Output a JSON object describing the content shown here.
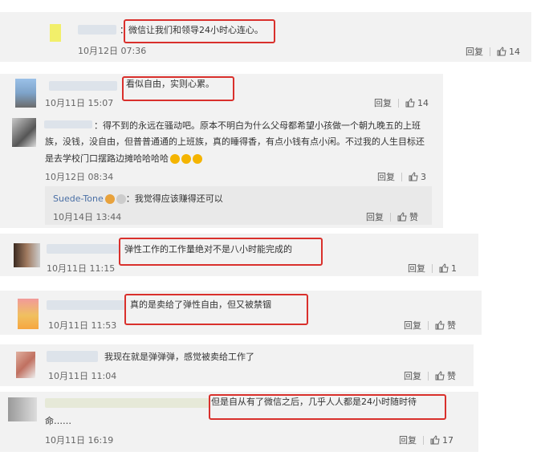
{
  "comments": [
    {
      "text": "：微信让我们和领导24小时心连心。",
      "time": "10月12日 07:36",
      "reply": "回复",
      "likes": "14"
    },
    {
      "text": "看似自由，实则心累。",
      "time": "10月11日 15:07",
      "reply": "回复",
      "likes": "14"
    },
    {
      "text_lines": [
        "：得不到的永远在骚动吧。原本不明白为什么父母都希望小孩做一个朝九晚五的上班",
        "族，没钱，没自由，但普普通通的上班族，真的睡得香，有点小钱有点小闲。不过我的人生目标还",
        "是去学校门口摆路边摊哈哈哈哈"
      ],
      "time": "10月12日 08:34",
      "reply": "回复",
      "likes": "3",
      "subreply": {
        "user": "Suede-Tone",
        "text": "：我觉得应该赚得还可以",
        "time": "10月14日 13:44",
        "reply": "回复",
        "likes": "赞"
      }
    },
    {
      "text": "弹性工作的工作量绝对不是八小时能完成的",
      "time": "10月11日 11:15",
      "reply": "回复",
      "likes": "1"
    },
    {
      "text": "真的是卖给了弹性自由，但又被禁锢",
      "time": "10月11日 11:53",
      "reply": "回复",
      "likes": "赞"
    },
    {
      "text": "我现在就是弹弹弹，感觉被卖给工作了",
      "time": "10月11日 11:04",
      "reply": "回复",
      "likes": "赞"
    },
    {
      "text_lines": [
        "但是自从有了微信之后，几乎人人都是24小时随时待",
        "命……"
      ],
      "time": "10月11日 16:19",
      "reply": "回复",
      "likes": "17"
    }
  ],
  "colors": {
    "highlight": "#d9302c",
    "card": "#f2f2f2"
  }
}
